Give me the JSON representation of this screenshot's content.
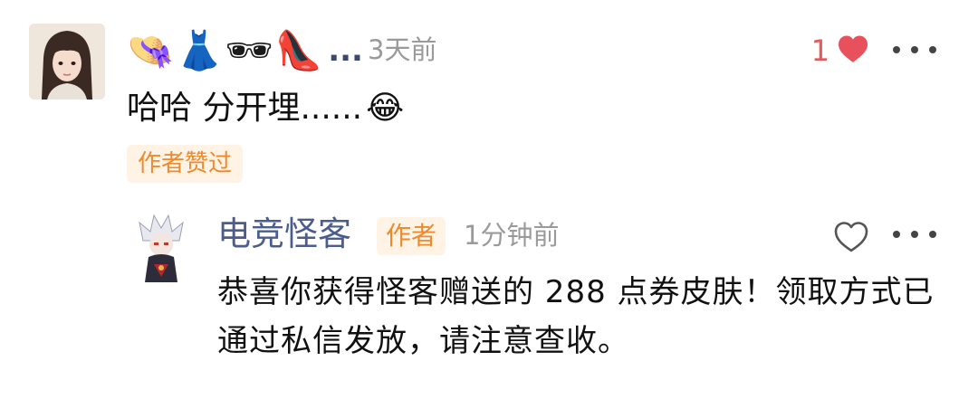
{
  "comment": {
    "username_emojis": "👒👗🕶👠",
    "username_ellipsis": "...",
    "time": "3天前",
    "like_count": "1",
    "body_text": "哈哈 分开埋......",
    "body_emoji": "😂",
    "author_liked_badge": "作者赞过",
    "icons": {
      "like": "heart-filled-icon",
      "more": "more-horizontal-icon"
    },
    "colors": {
      "like_active": "#e8505b",
      "badge_text": "#ef8a2c",
      "badge_bg": "#fff3e6"
    }
  },
  "reply": {
    "username": "电竞怪客",
    "author_tag": "作者",
    "time": "1分钟前",
    "body_text": "恭喜你获得怪客赠送的 288 点券皮肤！领取方式已通过私信发放，请注意查收。",
    "icons": {
      "like": "heart-outline-icon",
      "more": "more-horizontal-icon"
    },
    "colors": {
      "username": "#4a5d8c"
    }
  }
}
